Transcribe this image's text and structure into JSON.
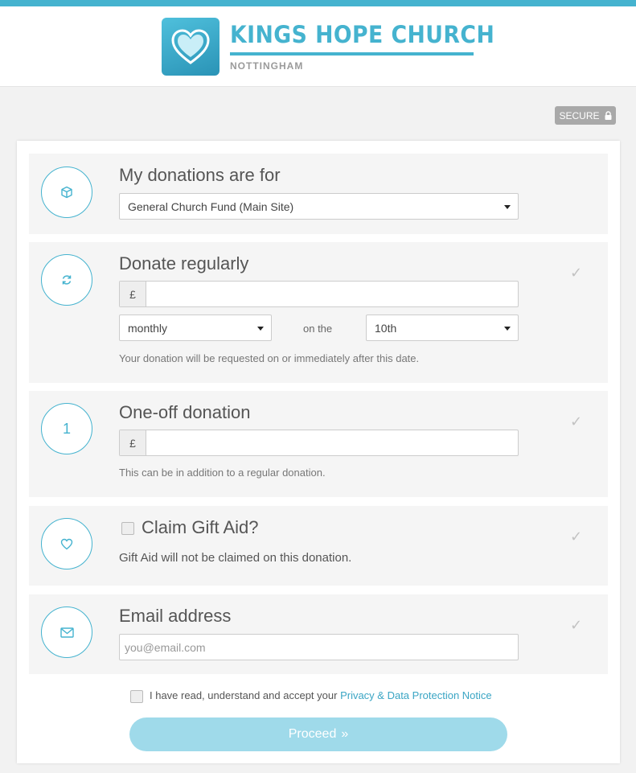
{
  "brand": {
    "name": "KINGS HOPE CHURCH",
    "location": "NOTTINGHAM",
    "accent_color": "#45b3cf"
  },
  "secure_badge": {
    "label": "SECURE",
    "icon": "lock-icon"
  },
  "donations_for": {
    "title": "My donations are for",
    "icon": "box-icon",
    "selected": "General Church Fund (Main Site)"
  },
  "regular": {
    "title": "Donate regularly",
    "icon": "refresh-icon",
    "currency": "£",
    "amount": "",
    "frequency": "monthly",
    "on_the_label": "on the",
    "day": "10th",
    "hint": "Your donation will be requested on or immediately after this date."
  },
  "one_off": {
    "title": "One-off donation",
    "icon_text": "1",
    "currency": "£",
    "amount": "",
    "hint": "This can be in addition to a regular donation."
  },
  "gift_aid": {
    "title": "Claim Gift Aid?",
    "icon": "heart-icon",
    "checked": false,
    "status": "Gift Aid will not be claimed on this donation."
  },
  "email": {
    "title": "Email address",
    "icon": "envelope-icon",
    "placeholder": "you@email.com"
  },
  "terms": {
    "prefix": "I have read, understand and accept your",
    "link": "Privacy & Data Protection Notice"
  },
  "proceed": {
    "label": "Proceed",
    "arrow": "»"
  }
}
